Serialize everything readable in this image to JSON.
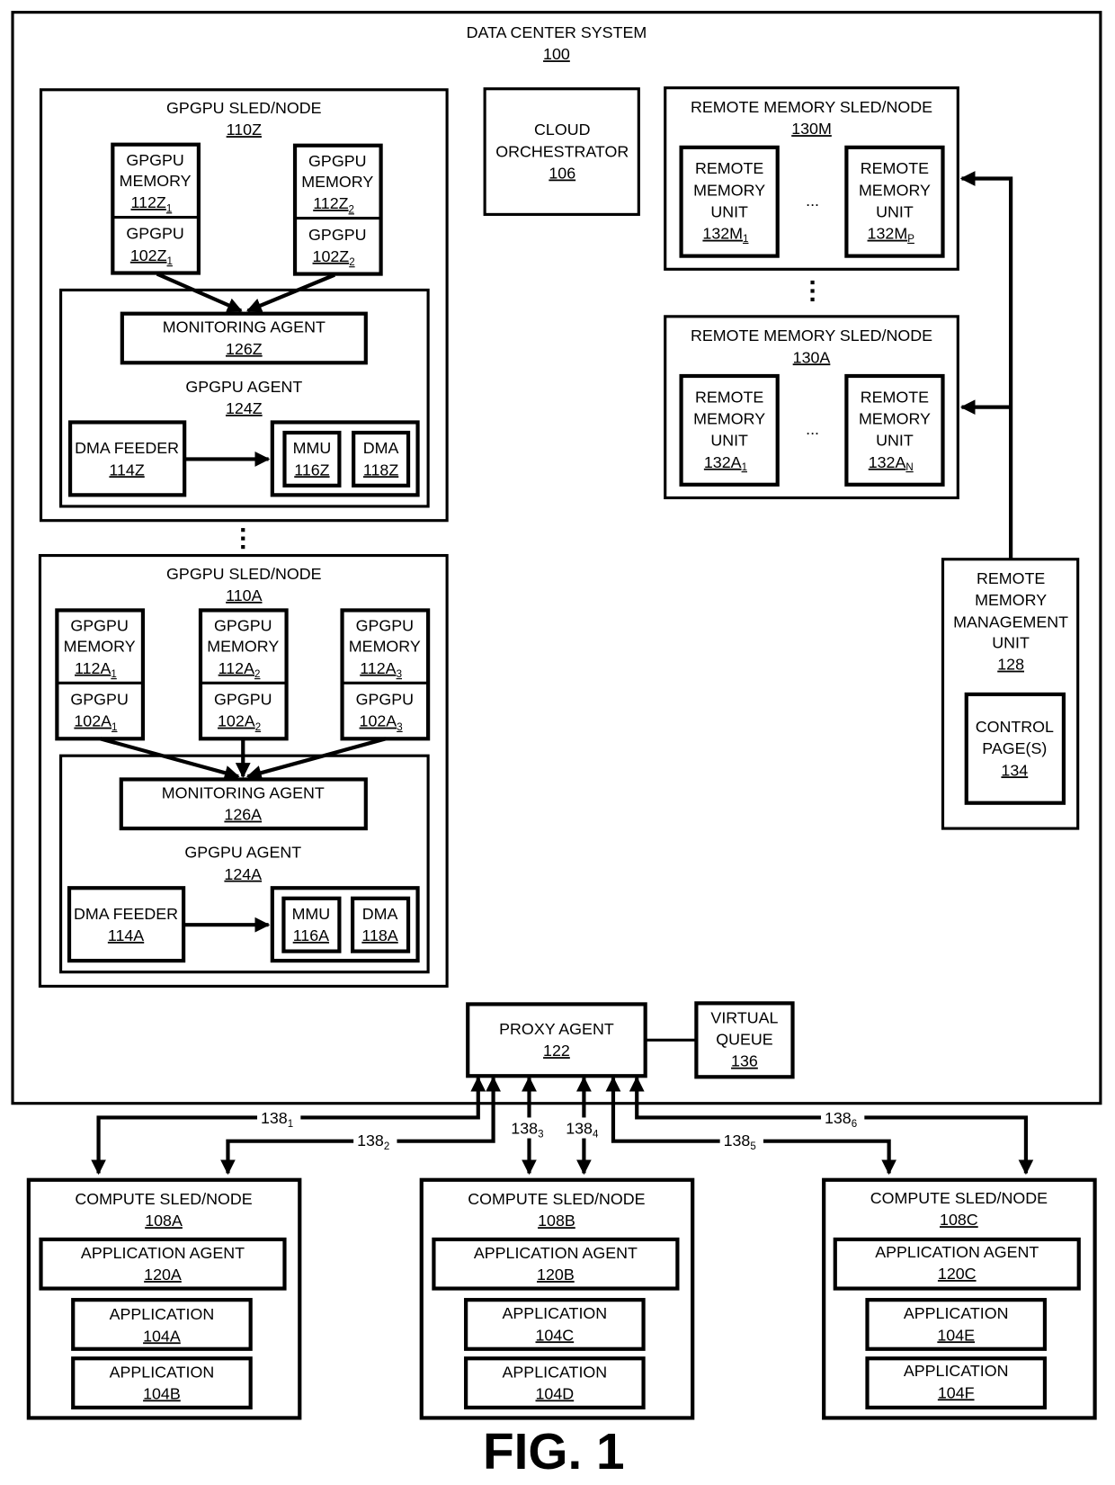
{
  "figure": {
    "label": "FIG. 1",
    "system": {
      "title": "DATA CENTER SYSTEM",
      "ref": "100"
    }
  },
  "cloud_orchestrator": {
    "lines": [
      "CLOUD",
      "ORCHESTRATOR"
    ],
    "ref": "106"
  },
  "gpgpu_sleds": [
    {
      "title": "GPGPU SLED/NODE",
      "ref": "110Z",
      "gpus": [
        {
          "memory_lines": [
            "GPGPU",
            "MEMORY"
          ],
          "memory_ref": "112Z",
          "memory_sub": "1",
          "gpu_label": "GPGPU",
          "gpu_ref": "102Z",
          "gpu_sub": "1"
        },
        {
          "memory_lines": [
            "GPGPU",
            "MEMORY"
          ],
          "memory_ref": "112Z",
          "memory_sub": "2",
          "gpu_label": "GPGPU",
          "gpu_ref": "102Z",
          "gpu_sub": "2"
        }
      ],
      "monitoring_agent": {
        "label": "MONITORING AGENT",
        "ref": "126Z"
      },
      "gpgpu_agent": {
        "label": "GPGPU AGENT",
        "ref": "124Z"
      },
      "dma_feeder": {
        "label": "DMA FEEDER",
        "ref": "114Z"
      },
      "mmu": {
        "label": "MMU",
        "ref": "116Z"
      },
      "dma": {
        "label": "DMA",
        "ref": "118Z"
      }
    },
    {
      "title": "GPGPU SLED/NODE",
      "ref": "110A",
      "gpus": [
        {
          "memory_lines": [
            "GPGPU",
            "MEMORY"
          ],
          "memory_ref": "112A",
          "memory_sub": "1",
          "gpu_label": "GPGPU",
          "gpu_ref": "102A",
          "gpu_sub": "1"
        },
        {
          "memory_lines": [
            "GPGPU",
            "MEMORY"
          ],
          "memory_ref": "112A",
          "memory_sub": "2",
          "gpu_label": "GPGPU",
          "gpu_ref": "102A",
          "gpu_sub": "2"
        },
        {
          "memory_lines": [
            "GPGPU",
            "MEMORY"
          ],
          "memory_ref": "112A",
          "memory_sub": "3",
          "gpu_label": "GPGPU",
          "gpu_ref": "102A",
          "gpu_sub": "3"
        }
      ],
      "monitoring_agent": {
        "label": "MONITORING AGENT",
        "ref": "126A"
      },
      "gpgpu_agent": {
        "label": "GPGPU AGENT",
        "ref": "124A"
      },
      "dma_feeder": {
        "label": "DMA FEEDER",
        "ref": "114A"
      },
      "mmu": {
        "label": "MMU",
        "ref": "116A"
      },
      "dma": {
        "label": "DMA",
        "ref": "118A"
      }
    }
  ],
  "remote_memory_sleds": [
    {
      "title": "REMOTE MEMORY SLED/NODE",
      "ref": "130M",
      "units": [
        {
          "lines": [
            "REMOTE",
            "MEMORY",
            "UNIT"
          ],
          "ref": "132M",
          "sub": "1"
        },
        {
          "lines": [
            "REMOTE",
            "MEMORY",
            "UNIT"
          ],
          "ref": "132M",
          "sub": "P"
        }
      ],
      "ellipsis": "..."
    },
    {
      "title": "REMOTE MEMORY SLED/NODE",
      "ref": "130A",
      "units": [
        {
          "lines": [
            "REMOTE",
            "MEMORY",
            "UNIT"
          ],
          "ref": "132A",
          "sub": "1"
        },
        {
          "lines": [
            "REMOTE",
            "MEMORY",
            "UNIT"
          ],
          "ref": "132A",
          "sub": "N"
        }
      ],
      "ellipsis": "..."
    }
  ],
  "remote_memory_management_unit": {
    "lines": [
      "REMOTE",
      "MEMORY",
      "MANAGEMENT",
      "UNIT"
    ],
    "ref": "128",
    "control_pages": {
      "lines": [
        "CONTROL",
        "PAGE(S)"
      ],
      "ref": "134"
    }
  },
  "proxy_agent": {
    "label": "PROXY AGENT",
    "ref": "122"
  },
  "virtual_queue": {
    "lines": [
      "VIRTUAL",
      "QUEUE"
    ],
    "ref": "136"
  },
  "links": [
    {
      "base": "138",
      "sub": "1"
    },
    {
      "base": "138",
      "sub": "2"
    },
    {
      "base": "138",
      "sub": "3"
    },
    {
      "base": "138",
      "sub": "4"
    },
    {
      "base": "138",
      "sub": "5"
    },
    {
      "base": "138",
      "sub": "6"
    }
  ],
  "compute_sleds": [
    {
      "title": "COMPUTE SLED/NODE",
      "ref": "108A",
      "agent": {
        "label": "APPLICATION AGENT",
        "ref": "120A"
      },
      "apps": [
        {
          "label": "APPLICATION",
          "ref": "104A"
        },
        {
          "label": "APPLICATION",
          "ref": "104B"
        }
      ]
    },
    {
      "title": "COMPUTE SLED/NODE",
      "ref": "108B",
      "agent": {
        "label": "APPLICATION AGENT",
        "ref": "120B"
      },
      "apps": [
        {
          "label": "APPLICATION",
          "ref": "104C"
        },
        {
          "label": "APPLICATION",
          "ref": "104D"
        }
      ]
    },
    {
      "title": "COMPUTE SLED/NODE",
      "ref": "108C",
      "agent": {
        "label": "APPLICATION AGENT",
        "ref": "120C"
      },
      "apps": [
        {
          "label": "APPLICATION",
          "ref": "104E"
        },
        {
          "label": "APPLICATION",
          "ref": "104F"
        }
      ]
    }
  ]
}
